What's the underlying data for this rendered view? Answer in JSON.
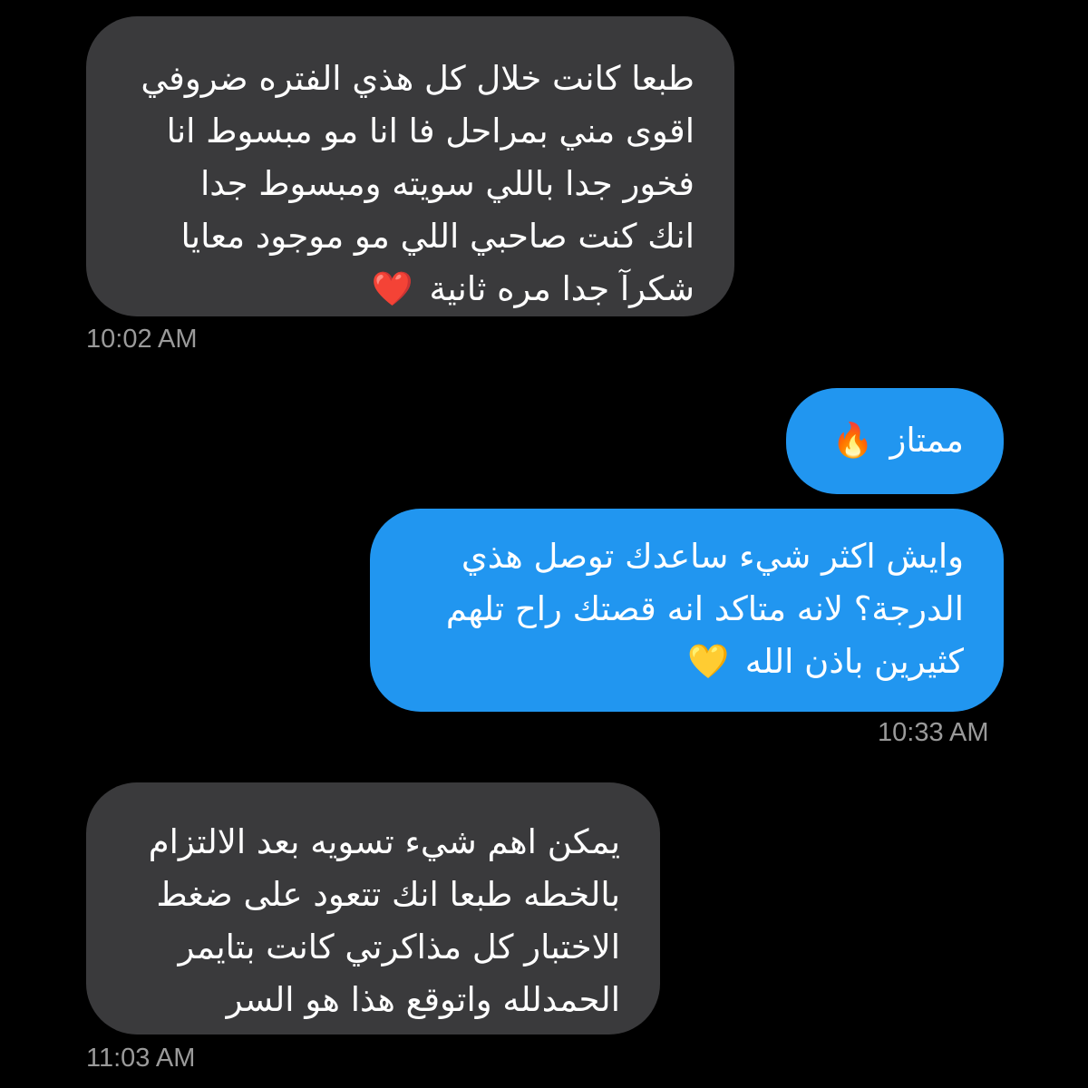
{
  "messages": [
    {
      "direction": "received",
      "lines": [
        "طبعا كانت خلال كل هذي الفتره ضروفي",
        "اقوى مني بمراحل فا انا مو مبسوط انا",
        "فخور جدا باللي سويته ومبسوط جدا",
        "انك كنت صاحبي اللي مو موجود معايا",
        "شكرآ جدا مره ثانية"
      ],
      "emoji": "❤️",
      "time": "10:02 AM"
    },
    {
      "direction": "sent",
      "lines": [
        "ممتاز"
      ],
      "emoji": "🔥"
    },
    {
      "direction": "sent",
      "lines": [
        "وايش اكثر شيء ساعدك توصل هذي",
        "الدرجة؟ لانه متاكد انه قصتك راح تلهم",
        "كثيرين باذن الله"
      ],
      "emoji": "💛",
      "time": "10:33 AM"
    },
    {
      "direction": "received",
      "lines": [
        "يمكن اهم شيء تسويه بعد الالتزام",
        "بالخطه طبعا انك تتعود على ضغط",
        "الاختبار كل مذاكرتي كانت بتايمر",
        "الحمدلله واتوقع هذا هو السر"
      ],
      "time": "11:03 AM"
    }
  ],
  "colors": {
    "background": "#000000",
    "received_bubble": "#3a3a3c",
    "sent_bubble": "#2196f0",
    "timestamp": "#9a9a9a"
  }
}
